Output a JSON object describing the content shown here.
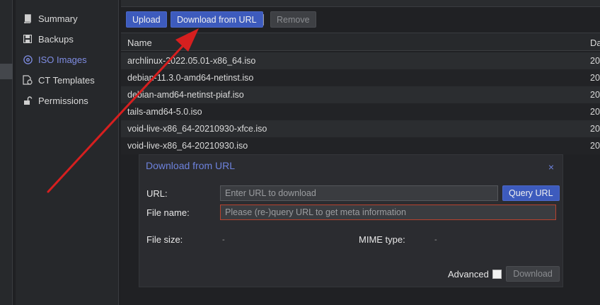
{
  "nav": {
    "items": [
      {
        "label": "Summary",
        "icon": "book-icon",
        "active": false
      },
      {
        "label": "Backups",
        "icon": "floppy-icon",
        "active": false
      },
      {
        "label": "ISO Images",
        "icon": "disc-icon",
        "active": true
      },
      {
        "label": "CT Templates",
        "icon": "template-icon",
        "active": false
      },
      {
        "label": "Permissions",
        "icon": "unlock-icon",
        "active": false
      }
    ]
  },
  "toolbar": {
    "upload": "Upload",
    "download_url": "Download from URL",
    "remove": "Remove"
  },
  "table": {
    "columns": [
      "Name",
      "Da"
    ],
    "rows": [
      {
        "name": "archlinux-2022.05.01-x86_64.iso",
        "date": "20"
      },
      {
        "name": "debian-11.3.0-amd64-netinst.iso",
        "date": "20"
      },
      {
        "name": "debian-amd64-netinst-piaf.iso",
        "date": "20"
      },
      {
        "name": "tails-amd64-5.0.iso",
        "date": "20"
      },
      {
        "name": "void-live-x86_64-20210930-xfce.iso",
        "date": "20"
      },
      {
        "name": "void-live-x86_64-20210930.iso",
        "date": "20"
      }
    ]
  },
  "dialog": {
    "title": "Download from URL",
    "close": "×",
    "url_label": "URL:",
    "url_placeholder": "Enter URL to download",
    "query_button": "Query URL",
    "filename_label": "File name:",
    "filename_placeholder": "Please (re-)query URL to get meta information",
    "filesize_label": "File size:",
    "filesize_value": "-",
    "mime_label": "MIME type:",
    "mime_value": "-",
    "advanced_label": "Advanced",
    "download_button": "Download"
  },
  "colors": {
    "accent": "#3d5bbd",
    "active_nav": "#7f8de3",
    "annotation_arrow": "#d61f1f",
    "invalid_border": "#b8432f"
  }
}
